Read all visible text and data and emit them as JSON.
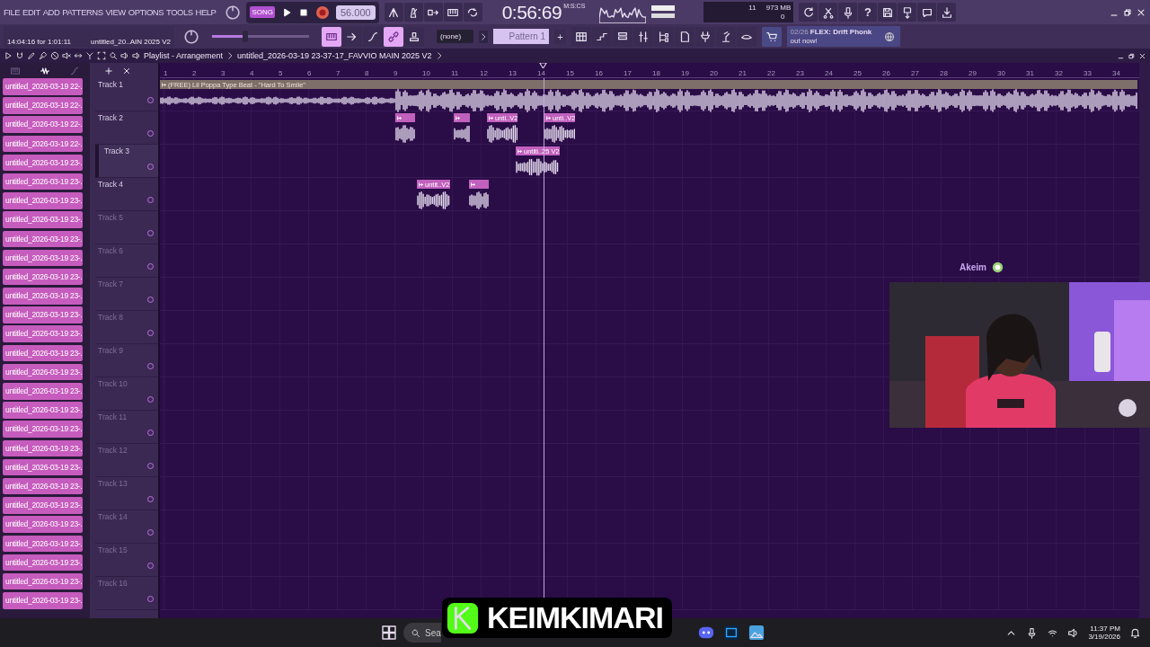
{
  "menu": [
    "FILE",
    "EDIT",
    "ADD",
    "PATTERNS",
    "VIEW",
    "OPTIONS",
    "TOOLS",
    "HELP"
  ],
  "transport": {
    "mode": "SONG",
    "tempo": "56.000",
    "time": "0:56:69",
    "time_unit": "M:S:CS"
  },
  "monitor": {
    "cpu": "11",
    "memory": "973 MB",
    "polyphony": "0"
  },
  "help_label": "?",
  "hint": {
    "time": "14:04:16 for 1:01:11",
    "project": "untitled_20..AIN 2025 V2"
  },
  "pitch": {
    "level": 0.34
  },
  "snap_buttons": [
    {
      "selected": true
    },
    {
      "selected": false
    },
    {
      "selected": false
    },
    {
      "selected": true
    },
    {
      "selected": false
    }
  ],
  "pattern_selector": {
    "channel": "(none)",
    "pattern": "Pattern 1",
    "add": "+"
  },
  "news": {
    "date": "02/26",
    "headline": "FLEX: Drift Phonk",
    "rest": "out now!"
  },
  "playlist": {
    "title": "Playlist - Arrangement",
    "project": "untitled_2026-03-19 23-37-17_FAVVIO MAIN 2025 V2"
  },
  "browser_items": [
    "untitled_2026-03-19 22-..",
    "untitled_2026-03-19 22-..",
    "untitled_2026-03-19 22-..",
    "untitled_2026-03-19 22-..",
    "untitled_2026-03-19 23-..",
    "untitled_2026-03-19 23-..",
    "untitled_2026-03-19 23-..",
    "untitled_2026-03-19 23-..",
    "untitled_2026-03-19 23-..",
    "untitled_2026-03-19 23-..",
    "untitled_2026-03-19 23-..",
    "untitled_2026-03-19 23-..",
    "untitled_2026-03-19 23-..",
    "untitled_2026-03-19 23-..",
    "untitled_2026-03-19 23-..",
    "untitled_2026-03-19 23-..",
    "untitled_2026-03-19 23-..",
    "untitled_2026-03-19 23-..",
    "untitled_2026-03-19 23-..",
    "untitled_2026-03-19 23-..",
    "untitled_2026-03-19 23-..",
    "untitled_2026-03-19 23-..",
    "untitled_2026-03-19 23-..",
    "untitled_2026-03-19 23-..",
    "untitled_2026-03-19 23-..",
    "untitled_2026-03-19 23-..",
    "untitled_2026-03-19 23-..",
    "untitled_2026-03-19 23-.."
  ],
  "ruler": [
    "1",
    "2",
    "3",
    "4",
    "5",
    "6",
    "7",
    "8",
    "9",
    "10",
    "11",
    "12",
    "13",
    "14",
    "15",
    "16",
    "17",
    "18",
    "19",
    "20",
    "21",
    "22",
    "23",
    "24",
    "25",
    "26",
    "27",
    "28",
    "29",
    "30",
    "31",
    "32",
    "33",
    "34"
  ],
  "tracks": [
    {
      "name": "Track 1",
      "selected": false,
      "empty": false,
      "clips": [
        {
          "kind": "audio",
          "label": "(FREE) Lil Poppa Type Beat - \"Hard To Smile\""
        }
      ]
    },
    {
      "name": "Track 2",
      "selected": false,
      "empty": false,
      "clips": [
        {
          "kind": "clip"
        },
        {
          "kind": "clip"
        },
        {
          "kind": "clip",
          "label": "unti..V2"
        },
        {
          "kind": "clip",
          "label": "unti..V2"
        }
      ]
    },
    {
      "name": "Track 3",
      "selected": true,
      "empty": false,
      "clips": [
        {
          "kind": "clip",
          "label": "untitl..25 V2"
        }
      ]
    },
    {
      "name": "Track 4",
      "selected": false,
      "empty": false,
      "clips": [
        {
          "kind": "clip",
          "label": "untit..V2"
        },
        {
          "kind": "clip"
        }
      ]
    },
    {
      "name": "Track 5",
      "selected": false,
      "empty": true
    },
    {
      "name": "Track 6",
      "selected": false,
      "empty": true
    },
    {
      "name": "Track 7",
      "selected": false,
      "empty": true
    },
    {
      "name": "Track 8",
      "selected": false,
      "empty": true
    },
    {
      "name": "Track 9",
      "selected": false,
      "empty": true
    },
    {
      "name": "Track 10",
      "selected": false,
      "empty": true
    },
    {
      "name": "Track 11",
      "selected": false,
      "empty": true
    },
    {
      "name": "Track 12",
      "selected": false,
      "empty": true
    },
    {
      "name": "Track 13",
      "selected": false,
      "empty": true
    },
    {
      "name": "Track 14",
      "selected": false,
      "empty": true
    },
    {
      "name": "Track 15",
      "selected": false,
      "empty": true
    },
    {
      "name": "Track 16",
      "selected": false,
      "empty": true
    }
  ],
  "streamer": {
    "name": "Akeim"
  },
  "overlay": {
    "channel": "KEIMKIMARI"
  },
  "taskbar": {
    "search": "Sea",
    "time": "11:37 PM",
    "date": "3/19/2026"
  }
}
